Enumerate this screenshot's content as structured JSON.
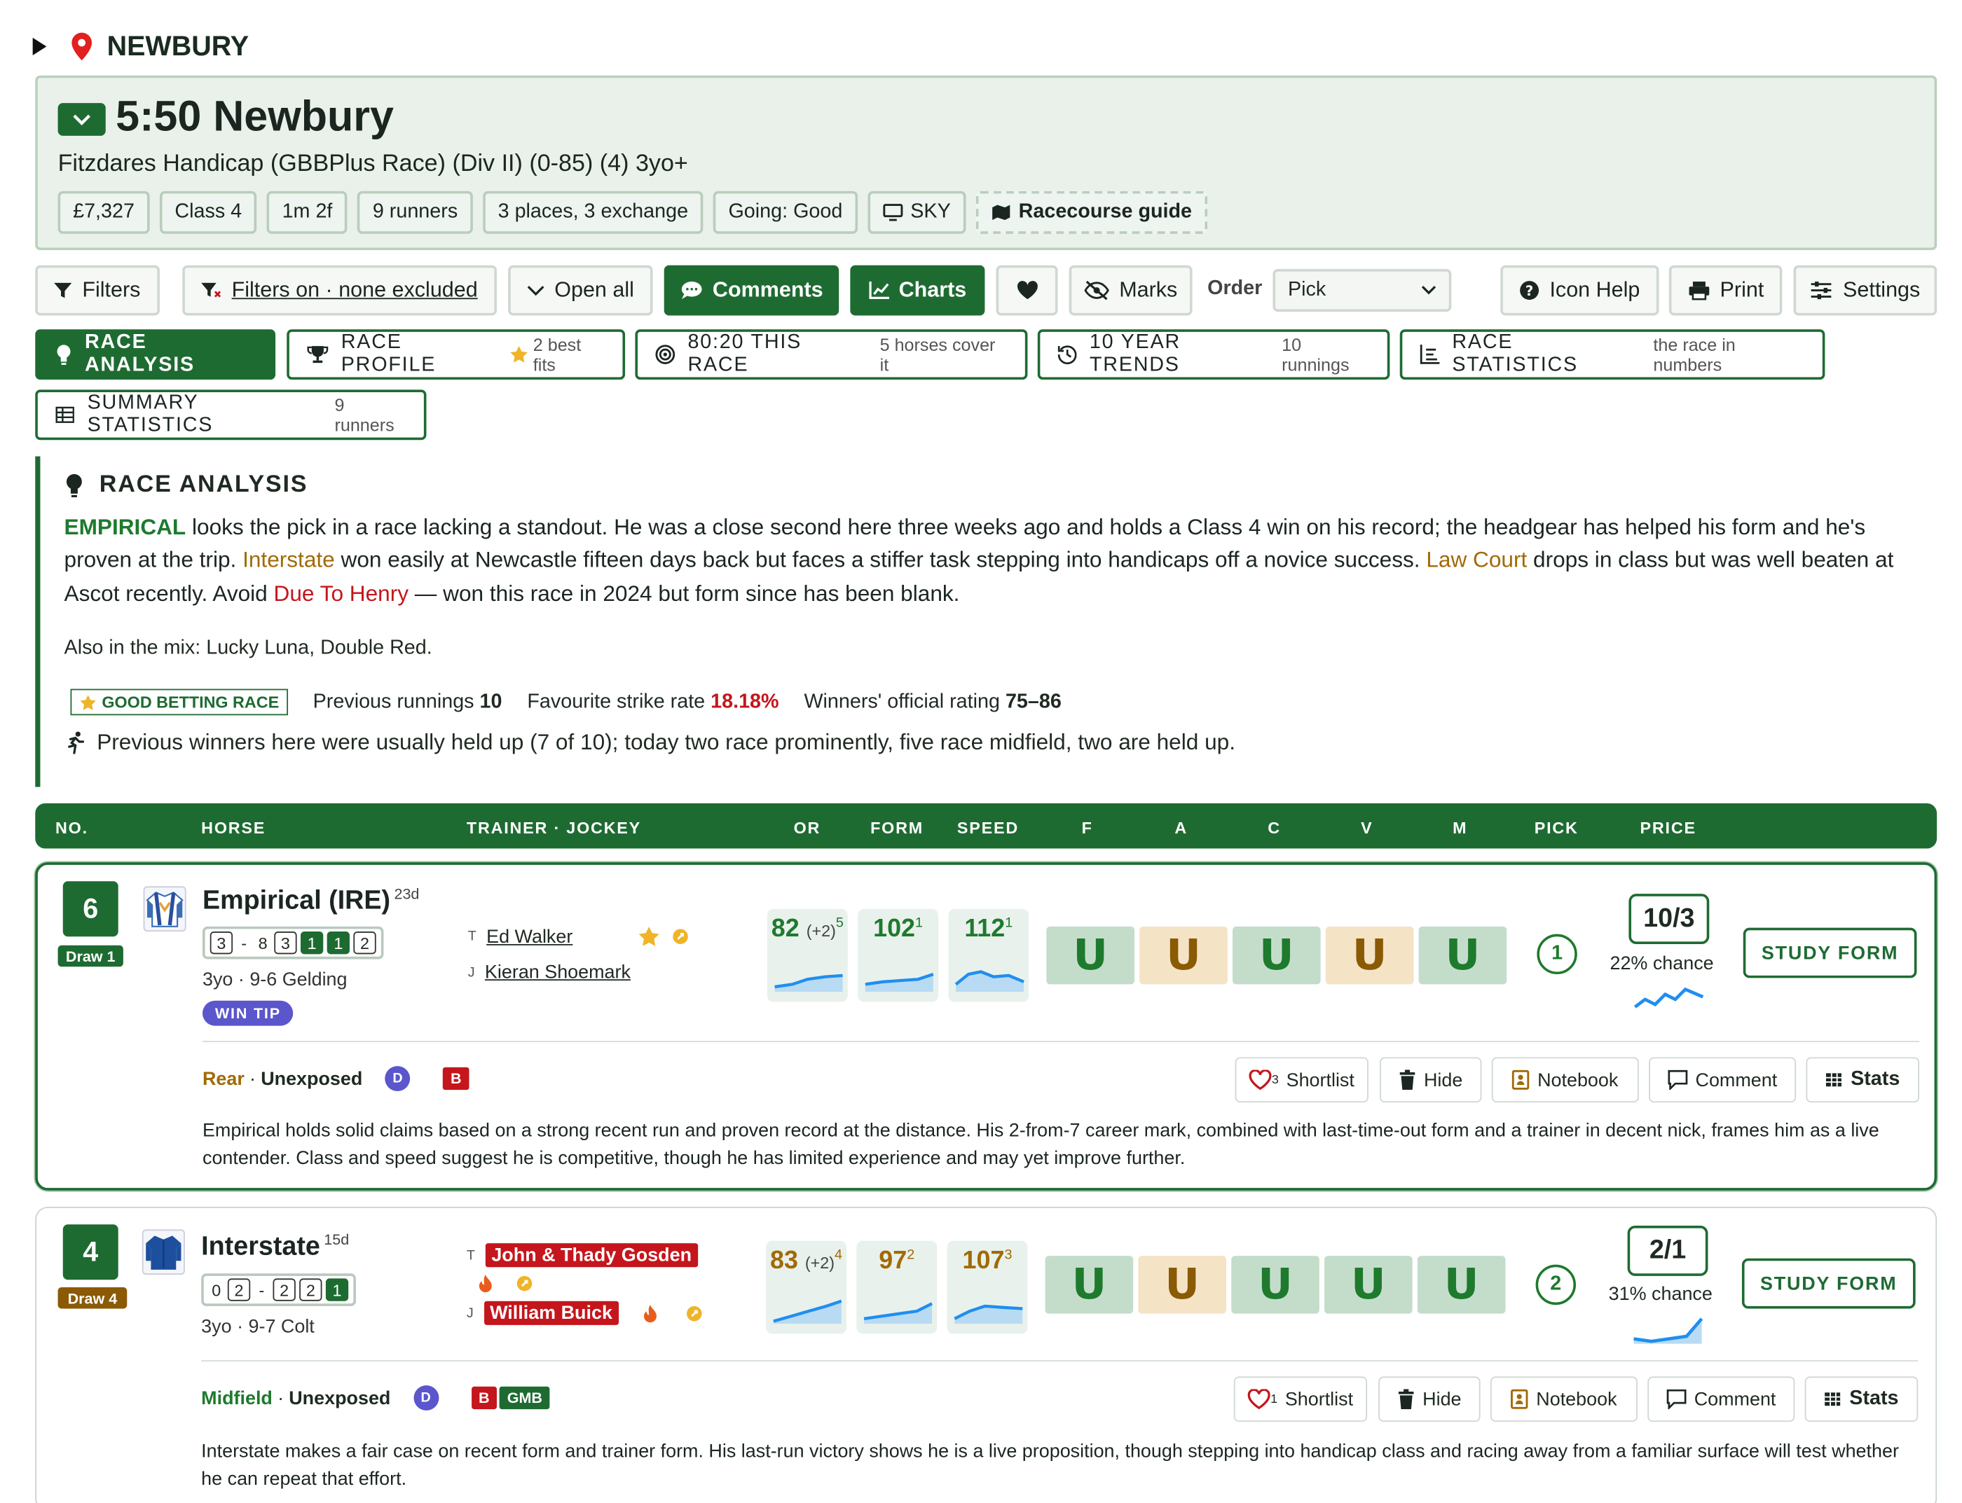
{
  "venue": {
    "name": "NEWBURY"
  },
  "race": {
    "title": "5:50 Newbury",
    "subtitle": "Fitzdares Handicap (GBBPlus Race) (Div II) (0-85) (4) 3yo+",
    "chips": [
      "£7,327",
      "Class 4",
      "1m 2f",
      "9 runners",
      "3 places, 3 exchange",
      "Going: Good",
      "SKY",
      "Racecourse guide"
    ]
  },
  "toolbar": {
    "filters": "Filters",
    "filters_on": "Filters on · none excluded",
    "open_all": "Open all",
    "comments": "Comments",
    "charts": "Charts",
    "marks": "Marks",
    "order_label": "Order",
    "order_value": "Pick",
    "icon_help": "Icon Help",
    "print": "Print",
    "settings": "Settings"
  },
  "tabs": [
    {
      "label": "RACE ANALYSIS",
      "meta": ""
    },
    {
      "label": "RACE PROFILE",
      "meta": "2 best fits"
    },
    {
      "label": "80:20 THIS RACE",
      "meta": "5 horses cover it"
    },
    {
      "label": "10 YEAR TRENDS",
      "meta": "10 runnings"
    },
    {
      "label": "RACE STATISTICS",
      "meta": "the race in numbers"
    },
    {
      "label": "SUMMARY STATISTICS",
      "meta": "9 runners"
    }
  ],
  "analysis": {
    "heading": "RACE ANALYSIS",
    "p1": "EMPIRICAL",
    "p2": " looks the pick in a race lacking a standout. He was a close second here three weeks ago and holds a Class 4 win on his record; the headgear has helped his form and he's proven at the trip. ",
    "p3": "Interstate",
    "p4": " won easily at Newcastle fifteen days back but faces a stiffer task stepping into handicaps off a novice success. ",
    "p5": "Law Court",
    "p6": " drops in class but was well beaten at Ascot recently. Avoid ",
    "p7": "Due To Henry",
    "p8": " — won this race in 2024 but form since has been blank.",
    "mix": "Also in the mix: Lucky Luna, Double Red.",
    "good_badge": "GOOD BETTING RACE",
    "prev_label": "Previous runnings",
    "prev_value": "10",
    "fav_label": "Favourite strike rate",
    "fav_value": "18.18%",
    "or_label": "Winners' official rating",
    "or_value": "75–86",
    "runstyle": "Previous winners here were usually held up (7 of 10); today two race prominently, five race midfield, two are held up."
  },
  "columns": [
    "NO.",
    "HORSE",
    "TRAINER · JOCKEY",
    "OR",
    "FORM",
    "SPEED",
    "F",
    "A",
    "C",
    "V",
    "M",
    "PICK",
    "PRICE"
  ],
  "runners": [
    {
      "no": "6",
      "draw": "Draw 1",
      "name": "Empirical (IRE)",
      "days": "23d",
      "form": [
        "3",
        "-",
        "8",
        "3",
        "1",
        "1",
        "2"
      ],
      "meta": "3yo · 9-6  Gelding",
      "tip": "WIN TIP",
      "trainer": "Ed Walker",
      "jockey": "Kieran Shoemark",
      "or": "82",
      "or_ex": "(+2)",
      "or_sup": "5",
      "form_fig": "102",
      "form_sup": "1",
      "speed": "112",
      "speed_sup": "1",
      "shoes": [
        "g",
        "o",
        "g",
        "o",
        "g"
      ],
      "pick": "1",
      "price": "10/3",
      "chance": "22% chance",
      "style": "Rear",
      "exposure": "Unexposed",
      "shortlist_count": "3",
      "actions": [
        "Shortlist",
        "Hide",
        "Notebook",
        "Comment",
        "Stats"
      ],
      "study": "STUDY FORM",
      "summary": "Empirical holds solid claims based on a strong recent run and proven record at the distance. His 2-from-7 career mark, combined with last-time-out form and a trainer in decent nick, frames him as a live contender. Class and speed suggest he is competitive, though he has limited experience and may yet improve further."
    },
    {
      "no": "4",
      "draw": "Draw 4",
      "name": "Interstate",
      "days": "15d",
      "form": [
        "0",
        "2",
        "-",
        "2",
        "2",
        "1"
      ],
      "meta": "3yo · 9-7  Colt",
      "tip": "",
      "trainer": "John & Thady Gosden",
      "jockey": "William Buick",
      "or": "83",
      "or_ex": "(+2)",
      "or_sup": "4",
      "form_fig": "97",
      "form_sup": "2",
      "speed": "107",
      "speed_sup": "3",
      "shoes": [
        "g",
        "o",
        "g",
        "g",
        "g"
      ],
      "pick": "2",
      "price": "2/1",
      "chance": "31% chance",
      "style": "Midfield",
      "exposure": "Unexposed",
      "shortlist_count": "1",
      "actions": [
        "Shortlist",
        "Hide",
        "Notebook",
        "Comment",
        "Stats"
      ],
      "study": "STUDY FORM",
      "summary": "Interstate makes a fair case on recent form and trainer form. His last-run victory shows he is a live proposition, though stepping into handicap class and racing away from a familiar surface will test whether he can repeat that effort."
    }
  ],
  "colors": {
    "accent": "#1e6b32",
    "red": "#c4161c",
    "amber": "#a16a05",
    "purple": "#5b56cc"
  }
}
